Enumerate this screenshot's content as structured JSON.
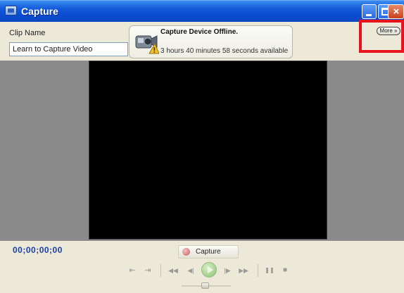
{
  "window": {
    "title": "Capture",
    "icon": "capture-app-icon",
    "close_glyph": "×"
  },
  "clip": {
    "label": "Clip Name",
    "value": "Learn to Capture Video"
  },
  "device": {
    "icon": "camera-icon",
    "status": "Capture Device Offline.",
    "available": "3 hours 40 minutes 58 seconds available"
  },
  "more_button": {
    "label": "More »"
  },
  "highlight": {
    "color": "#e8141c"
  },
  "timecode": "00;00;00;00",
  "capture_button": {
    "label": "Capture"
  },
  "transport": {
    "set_in": "⇤",
    "set_out": "⇥",
    "rewind": "◀◀",
    "step_back": "◀|",
    "step_forward": "|▶",
    "fast_forward": "▶▶",
    "pause": "❚❚",
    "stop": "■"
  }
}
